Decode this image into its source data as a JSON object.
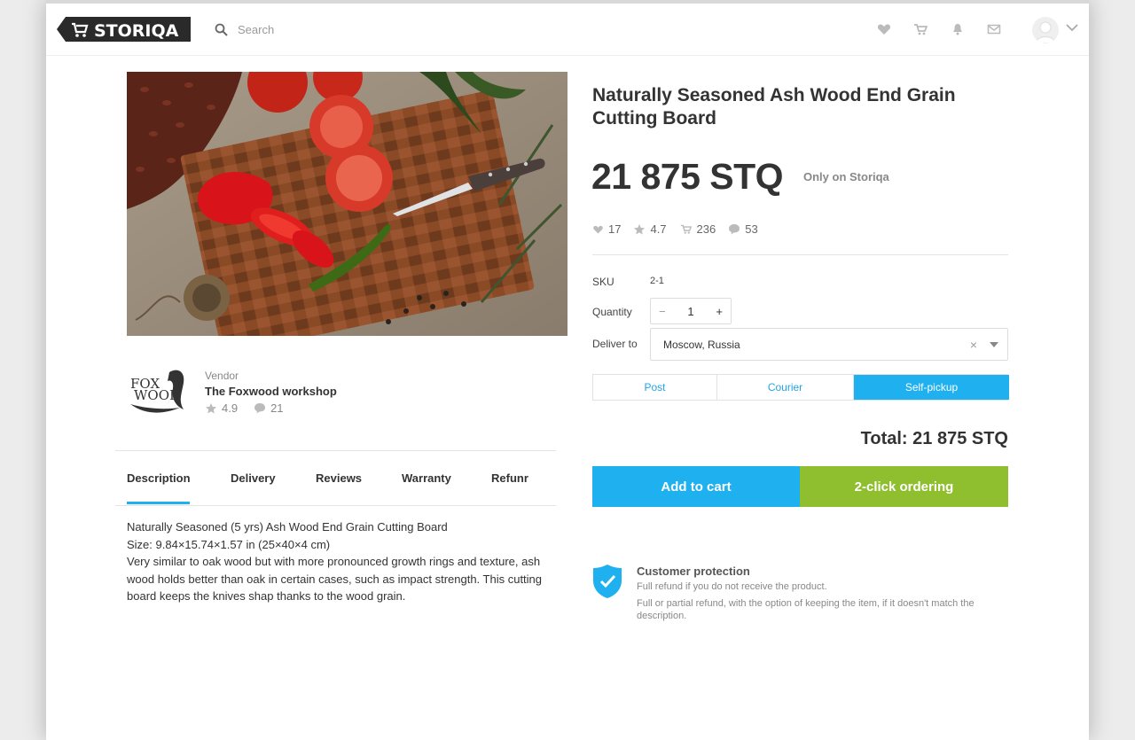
{
  "header": {
    "logo_text": "STORIQA",
    "search_placeholder": "Search",
    "icons": [
      "heart-icon",
      "cart-icon",
      "bell-icon",
      "mail-icon",
      "avatar",
      "chevron-down-icon"
    ]
  },
  "product": {
    "title": "Naturally Seasoned Ash Wood End Grain Cutting Board",
    "price": "21 875 STQ",
    "exclusive": "Only on Storiqa",
    "stats": {
      "likes": "17",
      "rating": "4.7",
      "orders": "236",
      "comments": "53"
    },
    "sku_label": "SKU",
    "sku_value": "2-1",
    "quantity_label": "Quantity",
    "quantity_value": "1",
    "deliver_label": "Deliver to",
    "deliver_value": "Moscow, Russia",
    "delivery_methods": [
      "Post",
      "Courier",
      "Self-pickup"
    ],
    "selected_delivery": "Self-pickup",
    "total": "Total: 21 875 STQ",
    "add_to_cart": "Add to cart",
    "two_click": "2-click ordering"
  },
  "vendor": {
    "caption": "Vendor",
    "name": "The Foxwood workshop",
    "logo_text_1": "FOX",
    "logo_text_2": "WOOD",
    "rating": "4.9",
    "comments": "21"
  },
  "tabs": [
    "Description",
    "Delivery",
    "Reviews",
    "Warranty",
    "Refunr"
  ],
  "active_tab": "Description",
  "description": {
    "line1": "Naturally Seasoned (5 yrs) Ash Wood End Grain Cutting Board",
    "line2": "Size: 9.84×15.74×1.57 in (25×40×4 cm)",
    "line3": "Very similar to oak wood but with more pronounced growth rings and texture, ash wood holds better than oak in certain cases, such as impact strength. This cutting board keeps the knives shap thanks to the wood grain."
  },
  "protection": {
    "title": "Customer protection",
    "line1": "Full refund if you do not receive the product.",
    "line2": "Full or partial refund, with the option of keeping the item, if it doesn't match the description."
  },
  "colors": {
    "accent_blue": "#1fb0f0",
    "accent_green": "#8fbf2f",
    "text_dark": "#333333"
  }
}
